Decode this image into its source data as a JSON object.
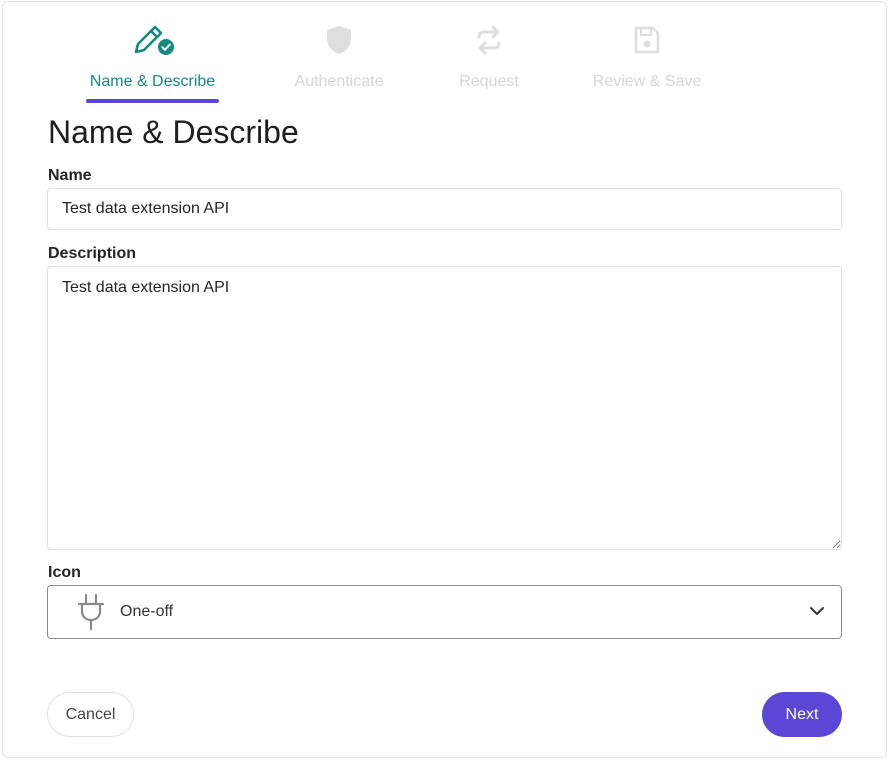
{
  "stepper": {
    "steps": [
      {
        "label": "Name & Describe",
        "icon": "pencil-check-icon",
        "state": "active"
      },
      {
        "label": "Authenticate",
        "icon": "shield-icon",
        "state": "inactive"
      },
      {
        "label": "Request",
        "icon": "arrows-exchange-icon",
        "state": "inactive"
      },
      {
        "label": "Review & Save",
        "icon": "floppy-disk-icon",
        "state": "inactive"
      }
    ]
  },
  "page": {
    "title": "Name & Describe"
  },
  "form": {
    "name_label": "Name",
    "name_value": "Test data extension API",
    "description_label": "Description",
    "description_value": "Test data extension API",
    "icon_label": "Icon",
    "icon_value": "One-off",
    "icon_glyph": "plug-icon"
  },
  "actions": {
    "cancel_label": "Cancel",
    "next_label": "Next"
  },
  "colors": {
    "accent": "#5b47d6",
    "active_step": "#138a7b",
    "inactive_step": "#d6d6d6"
  }
}
